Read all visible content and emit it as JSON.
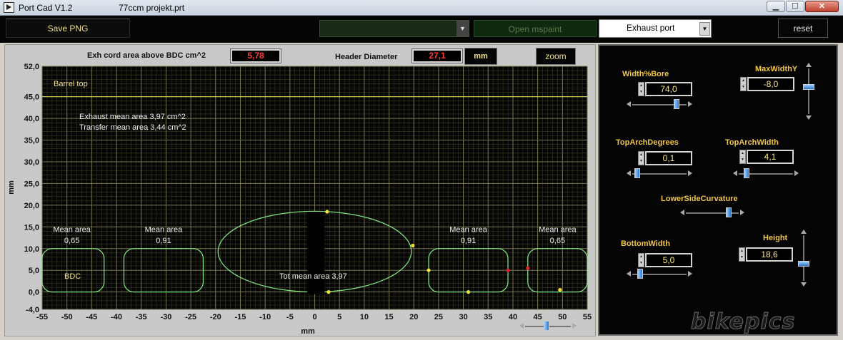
{
  "window": {
    "app_title": "Port Cad  V1.2",
    "file_name": "77ccm projekt.prt"
  },
  "toolbar": {
    "save_png": "Save PNG",
    "open_mspaint": "Open mspaint",
    "port_select": "Exhaust port",
    "reset": "reset"
  },
  "header": {
    "exh_cord_label": "Exh cord area above BDC  cm^2",
    "exh_cord_value": "5,78",
    "header_diameter_label": "Header Diameter",
    "header_diameter_value": "27,1",
    "unit": "mm",
    "zoom": "zoom"
  },
  "plot": {
    "xlabel": "mm",
    "ylabel": "mm",
    "xlim": [
      -55,
      55
    ],
    "ylim": [
      -4,
      52
    ],
    "xticks": [
      -55,
      -50,
      -45,
      -40,
      -35,
      -30,
      -25,
      -20,
      -15,
      -10,
      -5,
      0,
      5,
      10,
      15,
      20,
      25,
      30,
      35,
      40,
      45,
      50,
      55
    ],
    "yticks": [
      {
        "v": 52,
        "label": "52,0"
      },
      {
        "v": 45,
        "label": "45,0"
      },
      {
        "v": 40,
        "label": "40,0"
      },
      {
        "v": 35,
        "label": "35,0"
      },
      {
        "v": 30,
        "label": "30,0"
      },
      {
        "v": 25,
        "label": "25,0"
      },
      {
        "v": 20,
        "label": "20,0"
      },
      {
        "v": 15,
        "label": "15,0"
      },
      {
        "v": 10,
        "label": "10,0"
      },
      {
        "v": 5,
        "label": "5,0"
      },
      {
        "v": 0,
        "label": "0,0"
      },
      {
        "v": -4,
        "label": "-4,0"
      }
    ],
    "barrel_top_y": 45,
    "annotations": {
      "barrel_top": "Barrel top",
      "exhaust_mean": "Exhaust mean area  3,97 cm^2",
      "transfer_mean": "Transfer mean area 3,44 cm^2",
      "bdc": "BDC",
      "tot_mean": "Tot mean area 3,97",
      "mean_area_label": "Mean area"
    },
    "exhaust_port": {
      "cx": 0,
      "cy": 9.3,
      "rx": 19.5,
      "ry": 9.3
    },
    "transfer_ports": [
      {
        "x0": -55,
        "x1": -42.5,
        "y0": 0,
        "y1": 10,
        "mean": "0,65",
        "label_x": -49
      },
      {
        "x0": -38.5,
        "x1": -22.5,
        "y0": 0,
        "y1": 10,
        "mean": "0,91",
        "label_x": -30.5
      },
      {
        "x0": 23,
        "x1": 39,
        "y0": 0,
        "y1": 10,
        "mean": "0,91",
        "label_x": 31
      },
      {
        "x0": 43,
        "x1": 55,
        "y0": 0,
        "y1": 10,
        "mean": "0,65",
        "label_x": 49
      }
    ],
    "bridge": {
      "x0": -1.5,
      "x1": 2,
      "y0": -0.5,
      "y1": 18.5
    },
    "yellow_points": [
      [
        2.5,
        18.5
      ],
      [
        19.8,
        10.7
      ],
      [
        2.8,
        0
      ],
      [
        23,
        5
      ],
      [
        31,
        0
      ],
      [
        49.5,
        0.5
      ]
    ],
    "red_points": [
      [
        39,
        5
      ],
      [
        43,
        5.5
      ]
    ]
  },
  "controls": {
    "width_bore": {
      "label": "Width%Bore",
      "value": "74,0",
      "pos": 0.85
    },
    "max_width_y": {
      "label": "MaxWidthY",
      "value": "-8,0",
      "pos": 0.4
    },
    "top_arch_degrees": {
      "label": "TopArchDegrees",
      "value": "0,1",
      "pos": 0.05
    },
    "top_arch_width": {
      "label": "TopArchWidth",
      "value": "4,1",
      "pos": 0.1
    },
    "lower_side_curvature": {
      "label": "LowerSideCurvature",
      "pos": 0.85
    },
    "bottom_width": {
      "label": "BottomWidth",
      "value": "5,0",
      "pos": 0.1
    },
    "height": {
      "label": "Height",
      "value": "18,6",
      "pos": 0.65
    },
    "watermark": "bikepics"
  }
}
